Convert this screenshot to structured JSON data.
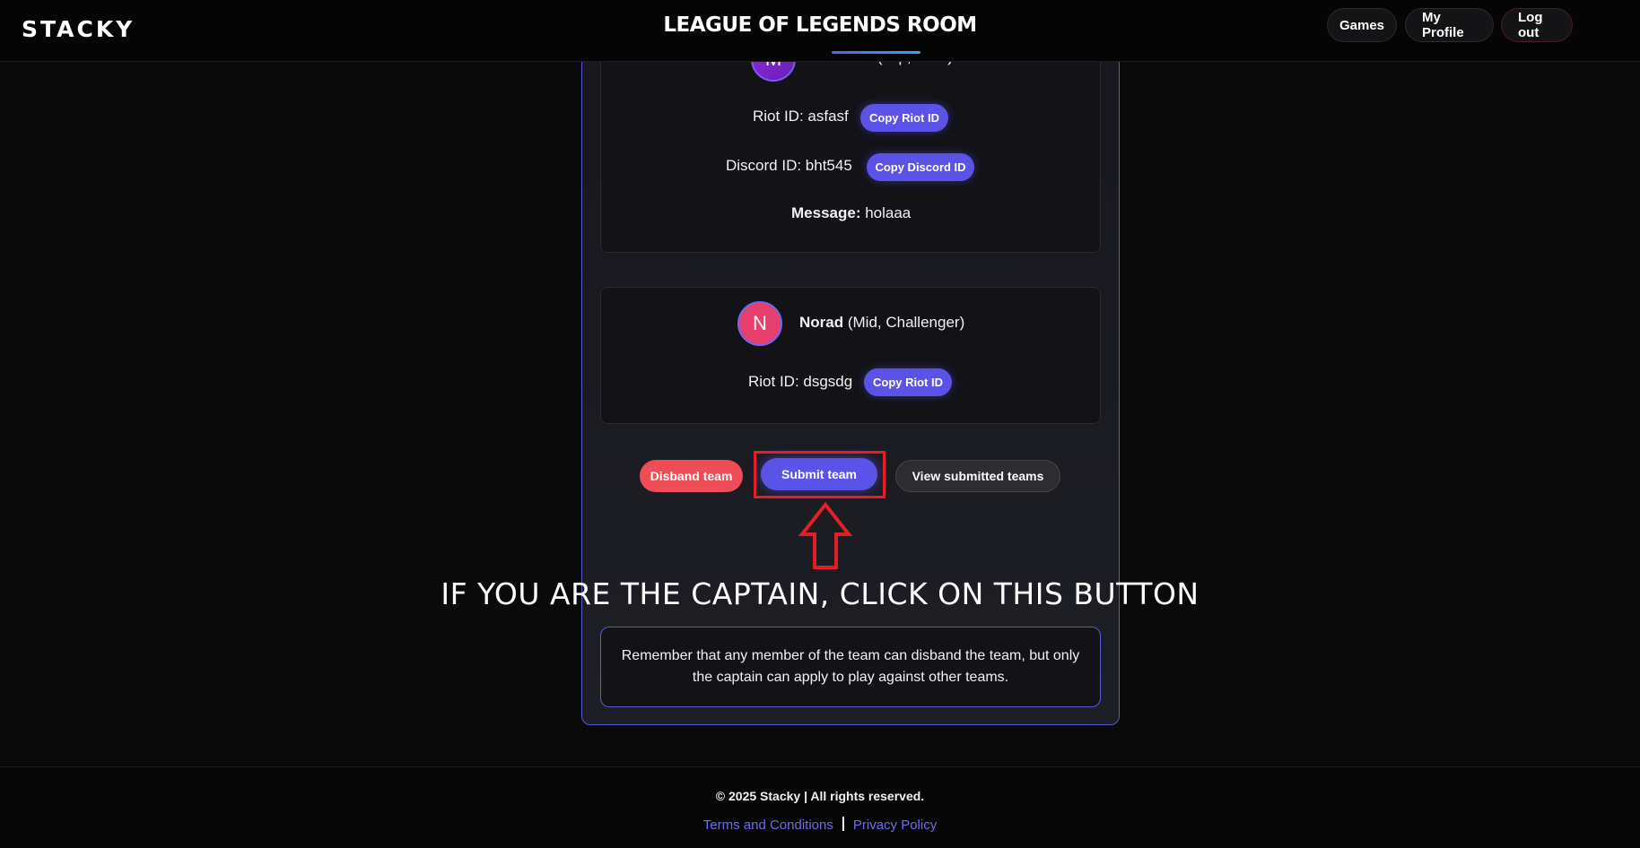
{
  "header": {
    "logo": "STACKY",
    "title": "LEAGUE OF LEGENDS ROOM",
    "nav": {
      "games": "Games",
      "profile": "My Profile",
      "logout": "Log out"
    }
  },
  "players": [
    {
      "avatar_letter": "M",
      "name": "Eminem",
      "details": " (Top, Gold)",
      "riot_label": "Riot ID: asfasf",
      "copy_riot": "Copy Riot ID",
      "discord_label": "Discord ID: bht545",
      "copy_discord": "Copy Discord ID",
      "message_label": "Message:",
      "message": " holaaa"
    },
    {
      "avatar_letter": "N",
      "name": "Norad",
      "details": " (Mid, Challenger)",
      "riot_label": "Riot ID: dsgsdg",
      "copy_riot": "Copy Riot ID"
    }
  ],
  "actions": {
    "disband": "Disband team",
    "submit": "Submit team",
    "view": "View submitted teams"
  },
  "annotation": {
    "text": "IF YOU ARE THE CAPTAIN, CLICK ON THIS BUTTON",
    "color": "#e41e26"
  },
  "reminder": "Remember that any member of the team can disband the team, but only the captain can apply to play against other teams.",
  "footer": {
    "copyright": "© 2025 Stacky | All rights reserved.",
    "terms": "Terms and Conditions",
    "privacy": "Privacy Policy"
  },
  "colors": {
    "accent": "#5b52e8",
    "danger": "#ee4d55",
    "link": "#6c6cf0"
  }
}
